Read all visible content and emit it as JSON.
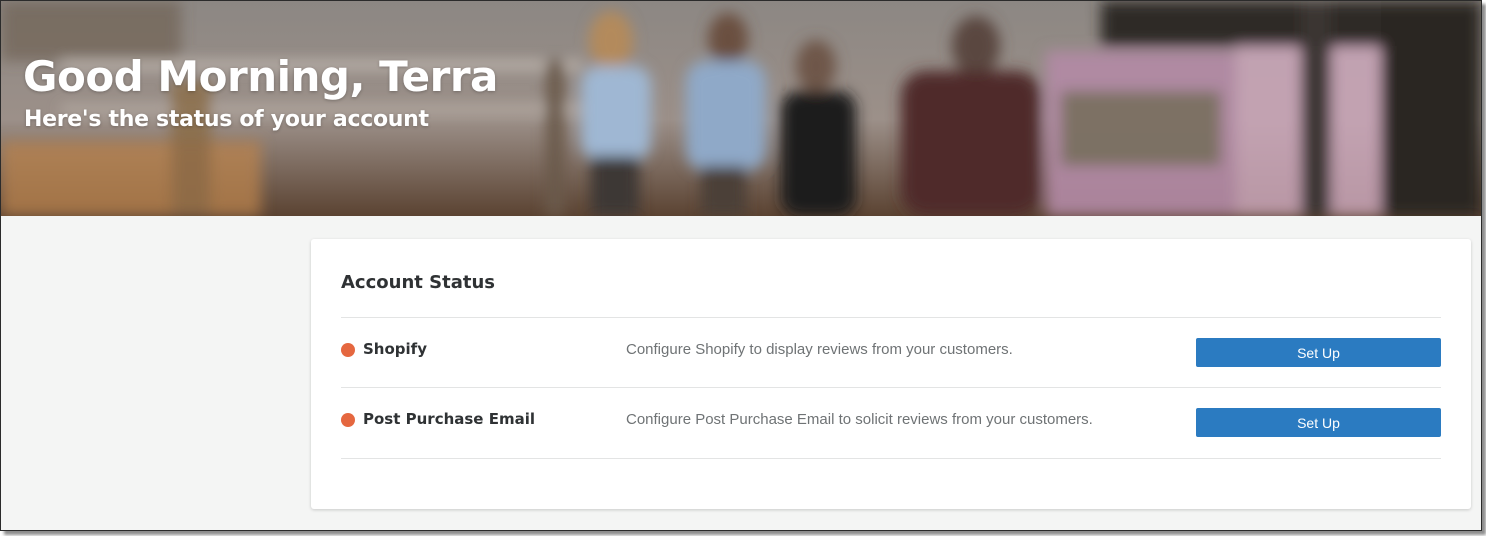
{
  "header": {
    "greeting": "Good Morning, Terra",
    "subtitle": "Here's the status of your account"
  },
  "account_status": {
    "title": "Account Status",
    "items": [
      {
        "name": "Shopify",
        "description": "Configure Shopify to display reviews from your customers.",
        "button_label": "Set Up",
        "status_color": "#e5673f"
      },
      {
        "name": "Post Purchase Email",
        "description": "Configure Post Purchase Email to solicit reviews from your customers.",
        "button_label": "Set Up",
        "status_color": "#e5673f"
      }
    ]
  },
  "colors": {
    "accent": "#2b7bc1",
    "status_incomplete": "#e5673f",
    "page_background": "#f4f5f4"
  }
}
